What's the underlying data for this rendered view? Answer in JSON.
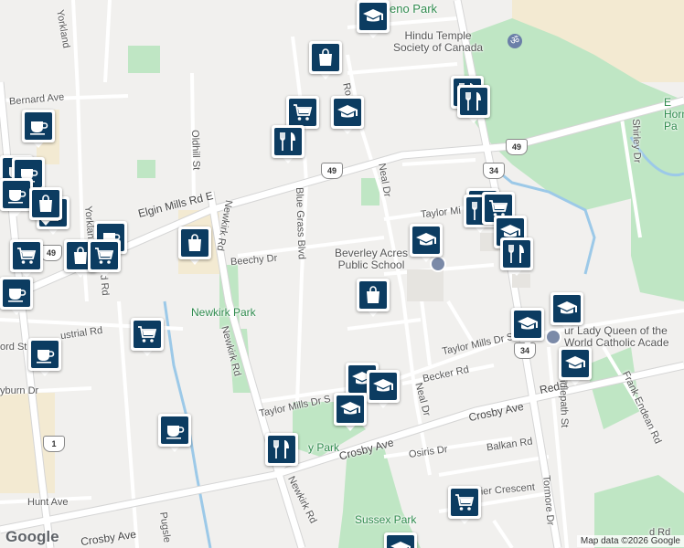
{
  "map": {
    "colors": {
      "background": "#f1f0ee",
      "park": "#bfe6c4",
      "industrial": "#f3ead2",
      "water": "#9cc9e8",
      "road": "#ffffff",
      "road_outline": "#d8d8d8",
      "marker": "#0c3c61"
    },
    "road_labels": {
      "bernard_ave": "Bernard Ave",
      "yorkland": "Yorkland",
      "oldhill_st": "Oldhill St",
      "elgin_mills_rd_e": "Elgin Mills Rd E",
      "newkirk_rd_north": "Newkirk Rd",
      "blue_grass_blvd": "Blue Grass Blvd",
      "beechy_dr": "Beechy Dr",
      "neal_dr_north": "Neal Dr",
      "ro_ch_dr": "Ro        ch Dr",
      "taylor_mills_n": "Taylor Mi",
      "taylor_mills_dr_s_east": "Taylor Mills Dr S",
      "taylor_mills_dr_s_west": "Taylor Mills Dr S",
      "becker_rd": "Becker Rd",
      "neal_dr_south": "Neal Dr",
      "crosby_ave_mid": "Crosby Ave",
      "crosby_ave_east": "Crosby Ave",
      "redstone": "Redst",
      "crosby_ave_west": "Crosby Ave",
      "osiris_dr": "Osiris Dr",
      "balkan_rd": "Balkan Rd",
      "cartier_crescent": "Cartier Crescent",
      "newkirk_rd_south": "Newkirk Rd",
      "newkirk_rd_mid": "Newkirk Rd",
      "bridlepath_st": "Bridlepath St",
      "frank_endean_rd": "Frank Endean Rd",
      "shirley_dr": "Shirley Dr",
      "tormore_dr": "Tormore Dr",
      "industrial_rd": "ustrial Rd",
      "yorkland_st": "Yorkland St",
      "ford_st": "ord St",
      "yburn_dr": "yburn Dr",
      "hunt_ave": "Hunt Ave",
      "pugsley": "Pugsle",
      "d_rd": "d Rd",
      "d_rd_bottom": "d Rd"
    },
    "places": {
      "heno_park": "eno Park",
      "hindu_temple": "Hindu Temple\nSociety of Canada",
      "beverley_acres": "Beverley Acres\nPublic School",
      "newkirk_park": "Newkirk Park",
      "y_park": "y Park",
      "sussex_park": "Sussex Park",
      "our_lady": "ur Lady Queen of the\nWorld Catholic Acade",
      "e_horn": "E\nHorn\nPa"
    },
    "highway_shields": [
      "49",
      "49",
      "49",
      "34",
      "34",
      "1"
    ],
    "markers": [
      {
        "icon": "school-icon"
      },
      {
        "icon": "shopping-bag-icon"
      },
      {
        "icon": "shopping-cart-icon"
      },
      {
        "icon": "school-icon"
      },
      {
        "icon": "restaurant-icon"
      },
      {
        "icon": "restaurant-icon"
      },
      {
        "icon": "restaurant-icon"
      },
      {
        "icon": "coffee-icon"
      },
      {
        "icon": "coffee-icon"
      },
      {
        "icon": "coffee-icon"
      },
      {
        "icon": "shopping-bag-icon"
      },
      {
        "icon": "coffee-icon"
      },
      {
        "icon": "shopping-bag-icon"
      },
      {
        "icon": "shopping-cart-icon"
      },
      {
        "icon": "coffee-icon"
      },
      {
        "icon": "shopping-bag-icon"
      },
      {
        "icon": "shopping-cart-icon"
      },
      {
        "icon": "coffee-icon"
      },
      {
        "icon": "shopping-bag-icon"
      },
      {
        "icon": "coffee-icon"
      },
      {
        "icon": "coffee-icon"
      },
      {
        "icon": "school-icon"
      },
      {
        "icon": "shopping-bag-icon"
      },
      {
        "icon": "shopping-cart-icon"
      },
      {
        "icon": "shopping-cart-icon"
      },
      {
        "icon": "restaurant-icon"
      },
      {
        "icon": "shopping-cart-icon"
      },
      {
        "icon": "school-icon"
      },
      {
        "icon": "restaurant-icon"
      },
      {
        "icon": "school-icon"
      },
      {
        "icon": "school-icon"
      },
      {
        "icon": "school-icon"
      },
      {
        "icon": "school-icon"
      },
      {
        "icon": "school-icon"
      },
      {
        "icon": "school-icon"
      },
      {
        "icon": "restaurant-icon"
      },
      {
        "icon": "shopping-cart-icon"
      },
      {
        "icon": "school-icon"
      }
    ],
    "google_logo": "Google",
    "attribution": "Map data ©2026 Google"
  }
}
